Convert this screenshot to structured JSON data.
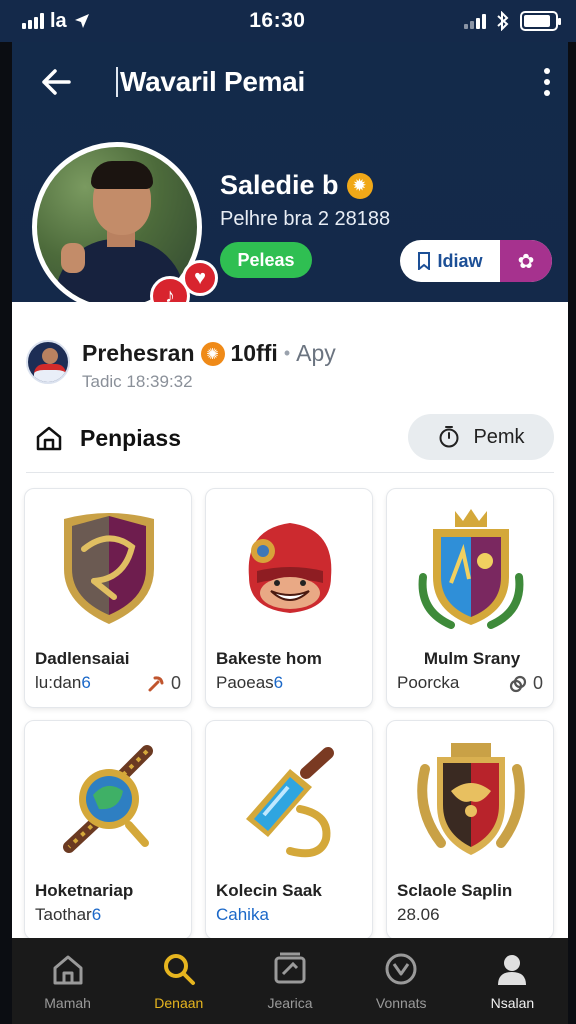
{
  "status_bar": {
    "network": "la",
    "time": "16:30",
    "battery_level": 0.85
  },
  "header": {
    "title": "Wavaril Pemai",
    "username": "Saledie b",
    "subtitle": "Pelhre bra 2 28188",
    "status_pill": "Peleas",
    "follow_label": "Idiaw"
  },
  "activity": {
    "name": "Prehesran",
    "count": "10ffi",
    "app": "Apy",
    "time": "Tadic 18:39:32"
  },
  "section": {
    "title": "Penpiass",
    "sort_label": "Pemk"
  },
  "items": [
    {
      "name": "Dadlensaiai",
      "sub": "lu:dan",
      "sub_accent": "6",
      "count": "0",
      "meta_icon": "pickaxe-icon",
      "art": "crest-shield"
    },
    {
      "name": "Bakeste hom",
      "sub": "Paoeas",
      "sub_accent": "6",
      "count": "",
      "meta_icon": "",
      "art": "red-helmet"
    },
    {
      "name": "Mulm Srany",
      "sub": "Poorcka",
      "sub_accent": "",
      "count": "0",
      "meta_icon": "link-icon",
      "art": "royal-shield"
    },
    {
      "name": "Hoketnariap",
      "sub": "Taothar",
      "sub_accent": "6",
      "count": "",
      "meta_icon": "",
      "art": "gem-amulet"
    },
    {
      "name": "Kolecin Saak",
      "sub": "Cahika",
      "sub_accent": "",
      "count": "",
      "meta_icon": "",
      "art": "crystal-hook"
    },
    {
      "name": "Sclaole Saplin",
      "sub": "28.06",
      "sub_accent": "",
      "count": "",
      "meta_icon": "",
      "art": "eagle-crest"
    }
  ],
  "bottom_nav": [
    {
      "label": "Mamah",
      "icon": "home-icon"
    },
    {
      "label": "Denaan",
      "icon": "search-icon"
    },
    {
      "label": "Jearica",
      "icon": "gallery-icon"
    },
    {
      "label": "Vonnats",
      "icon": "heart-icon"
    },
    {
      "label": "Nsalan",
      "icon": "profile-icon"
    }
  ],
  "colors": {
    "header_bg": "#14294a",
    "accent_green": "#2fbf52",
    "accent_purple": "#a6328e",
    "nav_active": "#e6b51f",
    "link_blue": "#1b68c8"
  }
}
